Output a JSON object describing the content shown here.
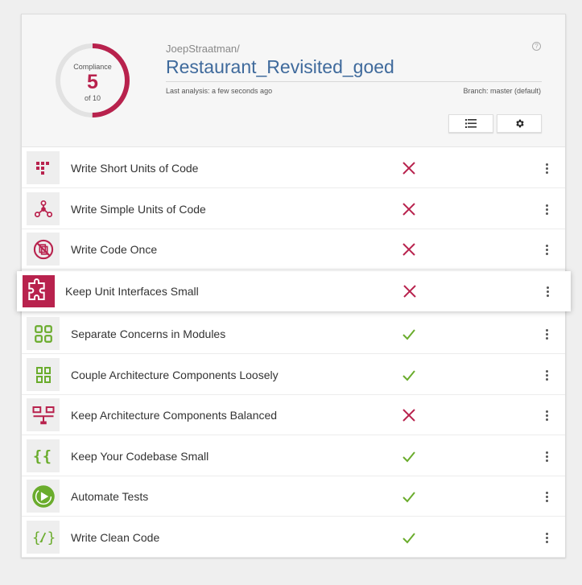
{
  "compliance": {
    "label": "Compliance",
    "value": "5",
    "of": "of 10",
    "score": 5,
    "max": 10,
    "color": "#b8224d"
  },
  "header": {
    "owner": "JoepStraatman/",
    "repo": "Restaurant_Revisited_goed",
    "last_analysis": "Last analysis: a few seconds ago",
    "branch": "Branch: master (default)",
    "help": "?"
  },
  "colors": {
    "fail": "#b8224d",
    "pass": "#6aac2c",
    "title": "#3f6a9c"
  },
  "guidelines": [
    {
      "label": "Write Short Units of Code",
      "status": "fail",
      "icon": "short-units-icon"
    },
    {
      "label": "Write Simple Units of Code",
      "status": "fail",
      "icon": "simple-units-icon"
    },
    {
      "label": "Write Code Once",
      "status": "fail",
      "icon": "code-once-icon"
    },
    {
      "label": "Keep Unit Interfaces Small",
      "status": "fail",
      "icon": "unit-interfaces-icon"
    },
    {
      "label": "Separate Concerns in Modules",
      "status": "pass",
      "icon": "separate-concerns-icon"
    },
    {
      "label": "Couple Architecture Components Loosely",
      "status": "pass",
      "icon": "couple-components-icon"
    },
    {
      "label": "Keep Architecture Components Balanced",
      "status": "fail",
      "icon": "balanced-components-icon"
    },
    {
      "label": "Keep Your Codebase Small",
      "status": "pass",
      "icon": "codebase-small-icon"
    },
    {
      "label": "Automate Tests",
      "status": "pass",
      "icon": "automate-tests-icon"
    },
    {
      "label": "Write Clean Code",
      "status": "pass",
      "icon": "clean-code-icon"
    }
  ]
}
